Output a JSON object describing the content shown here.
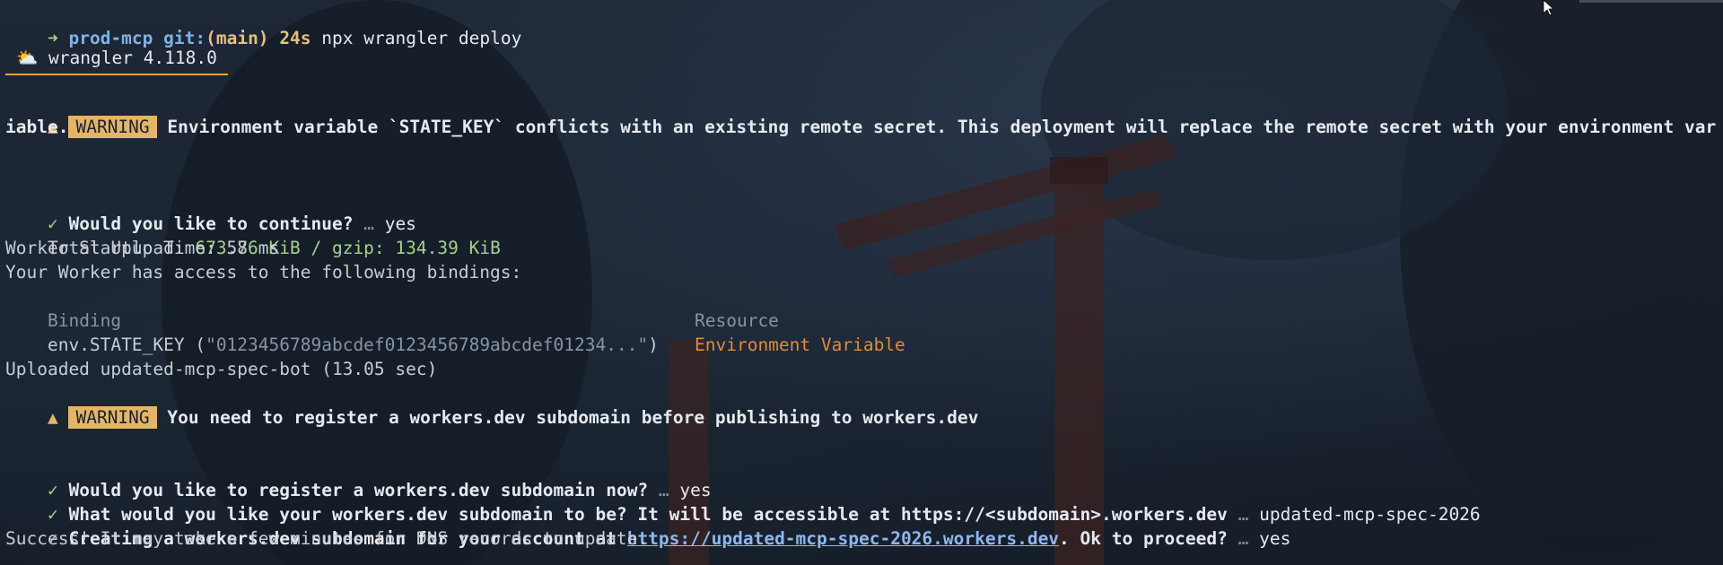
{
  "prompt": {
    "arrow": "➜",
    "dir": "prod-mcp",
    "git_label": "git:",
    "branch": "(main)",
    "duration": "24s",
    "command": "npx wrangler deploy"
  },
  "banner": {
    "icon": "⛅",
    "text": "wrangler 4.118.0"
  },
  "warning1": {
    "triangle": "▲",
    "badge": "WARNING",
    "text_line1": "Environment variable `STATE_KEY` conflicts with an existing remote secret. This deployment will replace the remote secret with your environment var",
    "text_line2": "iable."
  },
  "q_continue": {
    "check": "✓",
    "question": "Would you like to continue?",
    "sep": "…",
    "answer": "yes"
  },
  "upload": {
    "label": "Total Upload: ",
    "value": "673.76 KiB / gzip: 134.39 KiB"
  },
  "startup": "Worker Startup Time: 58 ms",
  "bindings_intro": "Your Worker has access to the following bindings:",
  "bindings_table": {
    "headers": [
      "Binding",
      "Resource"
    ],
    "rows": [
      {
        "binding_prefix": "env.STATE_KEY (",
        "binding_value": "\"0123456789abcdef0123456789abcdef01234...\"",
        "binding_suffix": ")",
        "resource": "Environment Variable"
      }
    ]
  },
  "uploaded": "Uploaded updated-mcp-spec-bot (13.05 sec)",
  "warning2": {
    "triangle": "▲",
    "badge": "WARNING",
    "text": "You need to register a workers.dev subdomain before publishing to workers.dev"
  },
  "q_register": {
    "check": "✓",
    "question": "Would you like to register a workers.dev subdomain now?",
    "sep": "…",
    "answer": "yes"
  },
  "q_subdomain": {
    "check": "✓",
    "question": "What would you like your workers.dev subdomain to be? It will be accessible at https://<subdomain>.workers.dev",
    "sep": "…",
    "answer": "updated-mcp-spec-2026"
  },
  "q_create": {
    "check": "✓",
    "prefix": "Creating a workers.dev subdomain for your account at ",
    "link": "https://updated-mcp-spec-2026.workers.dev",
    "suffix": ". Ok to proceed?",
    "sep": "…",
    "answer": "yes"
  },
  "success": "Success! It may take a few minutes for DNS records to update."
}
